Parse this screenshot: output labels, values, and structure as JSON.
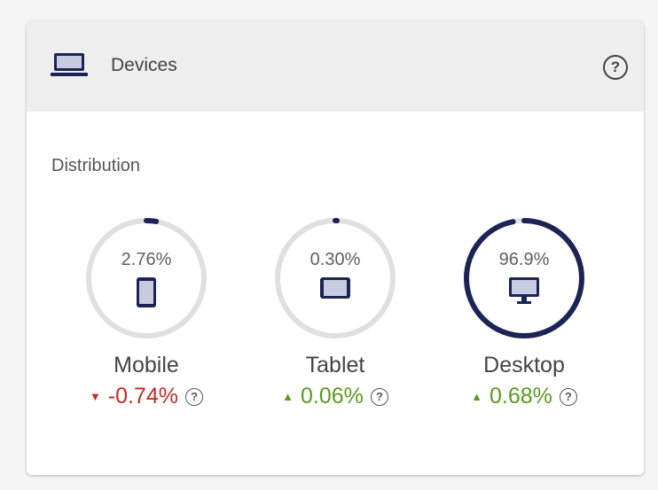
{
  "header": {
    "title": "Devices",
    "help_icon": "help-circle-icon"
  },
  "section": {
    "label": "Distribution"
  },
  "metrics": [
    {
      "id": "mobile",
      "label": "Mobile",
      "share": "2.76%",
      "share_value": 2.76,
      "change": "-0.74%",
      "direction": "down",
      "icon": "smartphone-icon"
    },
    {
      "id": "tablet",
      "label": "Tablet",
      "share": "0.30%",
      "share_value": 0.3,
      "change": "0.06%",
      "direction": "up",
      "icon": "tablet-icon"
    },
    {
      "id": "desktop",
      "label": "Desktop",
      "share": "96.9%",
      "share_value": 96.9,
      "change": "0.68%",
      "direction": "up",
      "icon": "desktop-icon"
    }
  ],
  "colors": {
    "ring_track": "#e0e0e0",
    "ring_fill": "#1c2455",
    "negative": "#c62828",
    "positive": "#5a9a1f"
  }
}
